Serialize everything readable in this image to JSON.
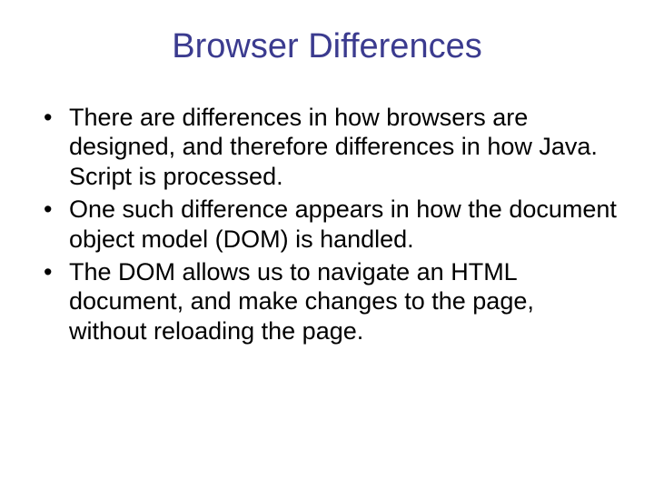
{
  "title": "Browser Differences",
  "bullets": [
    "There are differences in how browsers are designed, and therefore differences in how Java. Script is processed.",
    "One such difference appears in how the document object model (DOM) is handled.",
    "The DOM allows us to navigate an HTML document, and make changes to the page, without reloading the page."
  ]
}
